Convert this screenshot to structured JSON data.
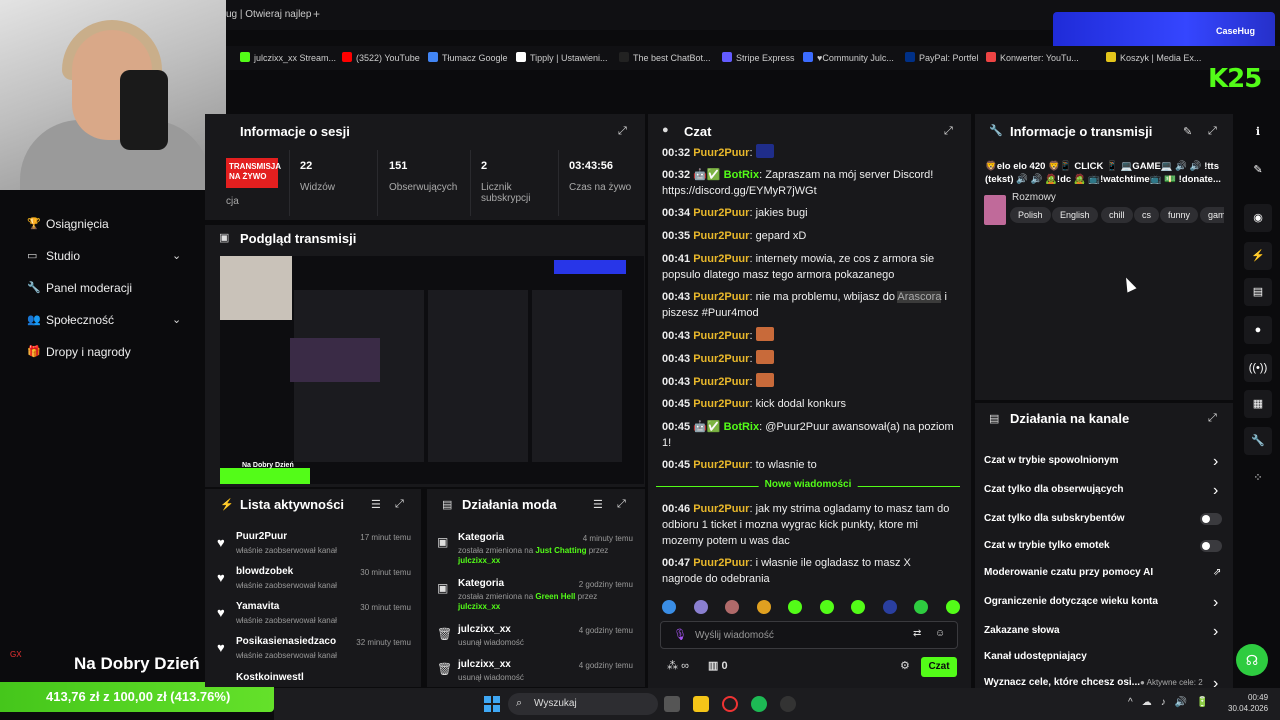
{
  "browser": {
    "active_tab": "ug | Otwieraj najlep",
    "new_tab": "+",
    "bookmarks": [
      "julczixx_xx Stream...",
      "(3522) YouTube",
      "Tłumacz Google",
      "Tipply | Ustawieni...",
      "The best ChatBot...",
      "Stripe Express",
      "♥Community Julc...",
      "PayPal: Portfel",
      "Konwerter: YouTu...",
      "Koszyk | Media Ex..."
    ],
    "bookmark_colors": [
      "#53fc18",
      "#ff0000",
      "#4285f4",
      "#ffffff",
      "#222222",
      "#635bff",
      "#3c6cff",
      "#003087",
      "#e44",
      "#e3c51b"
    ],
    "casehug": "CaseHug",
    "k25": "25"
  },
  "sidebar": {
    "items": [
      {
        "label": "Osiągnięcia",
        "icon": "trophy-icon",
        "chevron": false
      },
      {
        "label": "Studio",
        "icon": "monitor-icon",
        "chevron": true
      },
      {
        "label": "Panel moderacji",
        "icon": "wrench-icon",
        "chevron": false
      },
      {
        "label": "Społeczność",
        "icon": "users-icon",
        "chevron": true
      },
      {
        "label": "Dropy i nagrody",
        "icon": "gift-icon",
        "chevron": false
      }
    ]
  },
  "overlay": {
    "gx": "GX",
    "greeting": "Na Dobry Dzień",
    "goal": "413,76 zł z 100,00 zł (413.76%)"
  },
  "session": {
    "title": "Informacje o sesji",
    "badge": "TRANSMISJA\nNA ŻYWO",
    "badge_sub": "cja",
    "stats": [
      {
        "value": "22",
        "label": "Widzów"
      },
      {
        "value": "151",
        "label": "Obserwujących"
      },
      {
        "value": "2",
        "label": "Licznik subskrypcji"
      },
      {
        "value": "03:43:56",
        "label": "Czas na żywo"
      }
    ]
  },
  "preview": {
    "title": "Podgląd transmisji",
    "caption": "Na Dobry Dzień"
  },
  "activity": {
    "title": "Lista aktywności",
    "items": [
      {
        "name": "Puur2Puur",
        "action": "właśnie zaobserwował kanał",
        "time": "17 minut temu"
      },
      {
        "name": "blowdzobek",
        "action": "właśnie zaobserwował kanał",
        "time": "30 minut temu"
      },
      {
        "name": "Yamavita",
        "action": "właśnie zaobserwował kanał",
        "time": "30 minut temu"
      },
      {
        "name": "Posikasienasiedzaco",
        "action": "właśnie zaobserwował kanał",
        "time": "32 minuty temu"
      },
      {
        "name": "Kostkoinwestl",
        "action": "",
        "time": ""
      }
    ]
  },
  "mod_actions": {
    "title": "Działania moda",
    "items": [
      {
        "name": "Kategoria",
        "time": "4 minuty temu",
        "line1": "została zmieniona na ",
        "game": "Just Chatting",
        "by": " przez",
        "user": "julczixx_xx"
      },
      {
        "name": "Kategoria",
        "time": "2 godziny temu",
        "line1": "została zmieniona na ",
        "game": "Green Hell",
        "by": " przez",
        "user": "julczixx_xx"
      },
      {
        "name": "julczixx_xx",
        "time": "4 godziny temu",
        "line1": "usunął wiadomość",
        "game": "",
        "by": "",
        "user": ""
      },
      {
        "name": "julczixx_xx",
        "time": "4 godziny temu",
        "line1": "usunął wiadomość",
        "game": "",
        "by": "",
        "user": ""
      }
    ]
  },
  "chat": {
    "title": "Czat",
    "messages": [
      {
        "time": "00:32",
        "user": "Puur2Puur",
        "text": ""
      },
      {
        "time": "00:32",
        "user": "BotRix",
        "bot": true,
        "text": "Zapraszam na mój server Discord! https://discord.gg/EYMyR7jWGt"
      },
      {
        "time": "00:34",
        "user": "Puur2Puur",
        "text": "jakies bugi"
      },
      {
        "time": "00:35",
        "user": "Puur2Puur",
        "text": "gepard xD"
      },
      {
        "time": "00:41",
        "user": "Puur2Puur",
        "text": "internety mowia, ze cos z armora sie popsulo dlatego masz tego armora pokazanego"
      },
      {
        "time": "00:43",
        "user": "Puur2Puur",
        "text": "nie ma problemu, wbijasz do ",
        "hl": "Arascora",
        "text2": " i piszesz #Puur4mod"
      },
      {
        "time": "00:43",
        "user": "Puur2Puur",
        "emote": true,
        "text": ""
      },
      {
        "time": "00:43",
        "user": "Puur2Puur",
        "emote": true,
        "text": ""
      },
      {
        "time": "00:43",
        "user": "Puur2Puur",
        "emote": true,
        "text": ""
      },
      {
        "time": "00:45",
        "user": "Puur2Puur",
        "text": "kick dodal konkurs"
      },
      {
        "time": "00:45",
        "user": "BotRix",
        "bot": true,
        "text": "@Puur2Puur awansował(a) na poziom 1!"
      },
      {
        "time": "00:45",
        "user": "Puur2Puur",
        "text": "to wlasnie to"
      },
      {
        "time": "00:46",
        "user": "Puur2Puur",
        "text": "jak my strima ogladamy to masz tam do odbioru 1 ticket i mozna wygrac kick punkty, ktore mi mozemy potem u was dac"
      },
      {
        "time": "00:47",
        "user": "Puur2Puur",
        "text": "i własnie ile ogladasz to masz X nagrode do odebrania"
      }
    ],
    "new_messages": "Nowe wiadomości",
    "input_placeholder": "Wyślij wiadomość",
    "infinity": "∞",
    "points": "0",
    "send": "Czat"
  },
  "stream_info": {
    "title": "Informacje o transmisji",
    "stream_title": "🦁elo elo 420 🦁📱 CLICK 📱 💻GAME💻 🔊 🔊 !tts (tekst) 🔊 🔊 🧟!dc 🧟 📺!watchtime📺 💵 !donate...",
    "category": "Rozmowy",
    "tags": [
      "Polish",
      "English",
      "chill",
      "cs",
      "funny",
      "gam"
    ]
  },
  "channel_actions": {
    "title": "Działania na kanale",
    "rows": [
      {
        "label": "Czat w trybie spowolnionym",
        "control": "arrow"
      },
      {
        "label": "Czat tylko dla obserwujących",
        "control": "arrow"
      },
      {
        "label": "Czat tylko dla subskrybentów",
        "control": "toggle"
      },
      {
        "label": "Czat w trybie tylko emotek",
        "control": "toggle"
      },
      {
        "label": "Moderowanie czatu przy pomocy AI",
        "control": "external"
      },
      {
        "label": "Ograniczenie dotyczące wieku konta",
        "control": "arrow"
      },
      {
        "label": "Zakazane słowa",
        "control": "arrow"
      },
      {
        "label": "Kanał udostępniający",
        "control": "none"
      },
      {
        "label": "Wyznacz cele, które chcesz osi...",
        "control": "arrow",
        "extra": "● Aktywne cele: 2"
      }
    ]
  },
  "taskbar": {
    "search": "Wyszukaj",
    "time": "00:49",
    "date": "30.04.2026"
  },
  "colors": {
    "accent": "#53fc18",
    "panel": "#18181b",
    "bg": "#0b0b0d",
    "username": "#e9b82b"
  }
}
